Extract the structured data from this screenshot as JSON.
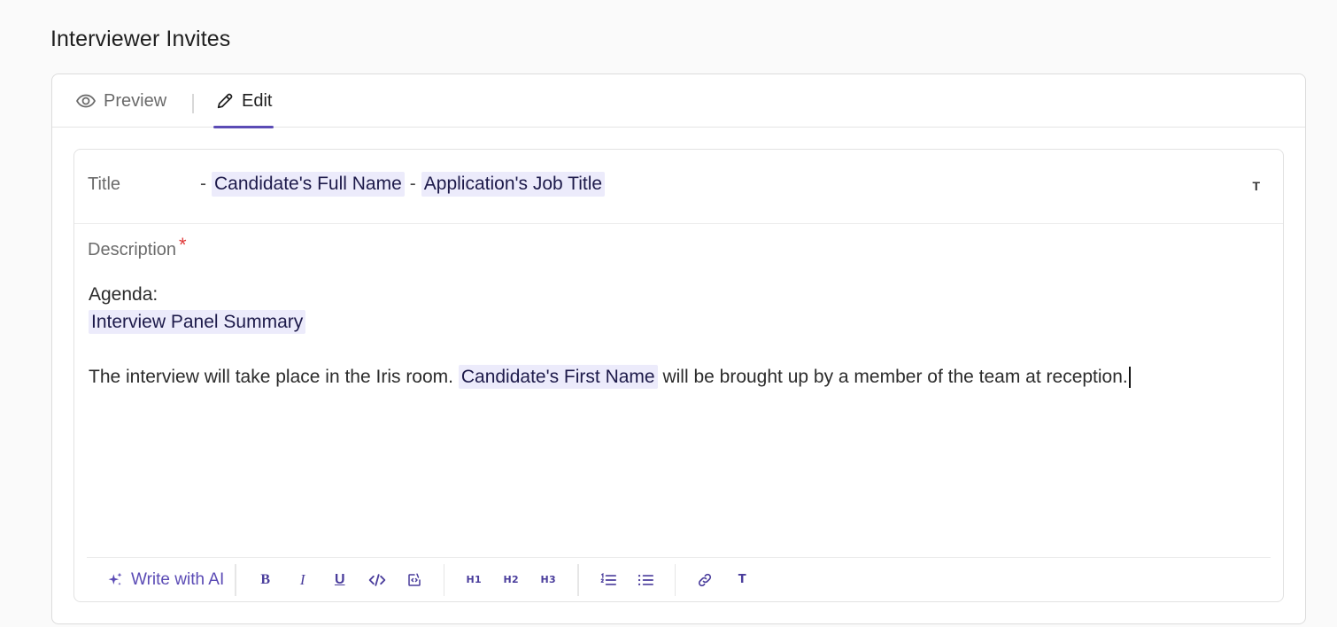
{
  "section": {
    "title": "Interviewer Invites"
  },
  "tabs": {
    "preview_label": "Preview",
    "edit_label": "Edit",
    "active": "Edit"
  },
  "editor": {
    "title_label": "Title",
    "title_separator_1": "-",
    "title_token_1": "Candidate's Full Name",
    "title_separator_2": "-",
    "title_token_2": "Application's Job Title",
    "title_format_icon": "T",
    "description_label": "Description",
    "required_marker": "*",
    "content": {
      "agenda": "Agenda:",
      "token_panel": "Interview Panel Summary",
      "para_start": "The interview will take place in the Iris room.",
      "token_first_name": "Candidate's First Name",
      "para_end": "will be brought up by a member of the team at reception."
    }
  },
  "toolbar": {
    "ai_label": "Write with AI",
    "bold": "B",
    "italic": "I",
    "underline": "U",
    "h1": "H1",
    "h2": "H2",
    "h3": "H3",
    "token": "T"
  },
  "colors": {
    "accent": "#5b4bb5",
    "token_bg": "#ecebfb",
    "required": "#e03a3a"
  }
}
